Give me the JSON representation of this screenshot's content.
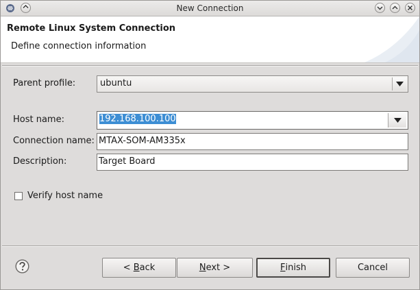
{
  "window": {
    "title": "New Connection"
  },
  "header": {
    "title": "Remote Linux System Connection",
    "subtitle": "Define connection information"
  },
  "form": {
    "parent_profile": {
      "label": "Parent profile:",
      "value": "ubuntu"
    },
    "host_name": {
      "label": "Host name:",
      "value": "192.168.100.100"
    },
    "connection_name": {
      "label": "Connection name:",
      "value": "MTAX-SOM-AM335x"
    },
    "description": {
      "label": "Description:",
      "value": "Target Board"
    },
    "verify_host": {
      "label": "Verify host name",
      "checked": false
    }
  },
  "buttons": {
    "back": {
      "pre": "< ",
      "mnemonic": "B",
      "rest": "ack"
    },
    "next": {
      "mnemonic": "N",
      "rest": "ext >"
    },
    "finish": {
      "mnemonic": "F",
      "rest": "inish"
    },
    "cancel": "Cancel"
  },
  "colors": {
    "selection": "#3d8ed4",
    "dialog_bg": "#dedcdb"
  },
  "icons": {
    "app": "eclipse-menu-icon",
    "help": "help-icon"
  }
}
